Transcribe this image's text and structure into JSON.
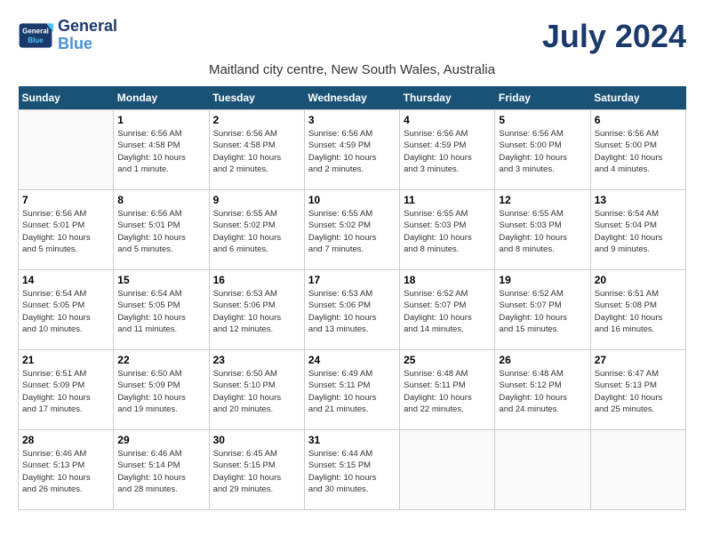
{
  "header": {
    "logo_line1": "General",
    "logo_line2": "Blue",
    "month_title": "July 2024",
    "location": "Maitland city centre, New South Wales, Australia"
  },
  "calendar": {
    "days_of_week": [
      "Sunday",
      "Monday",
      "Tuesday",
      "Wednesday",
      "Thursday",
      "Friday",
      "Saturday"
    ],
    "weeks": [
      [
        {
          "day": "",
          "info": ""
        },
        {
          "day": "1",
          "info": "Sunrise: 6:56 AM\nSunset: 4:58 PM\nDaylight: 10 hours\nand 1 minute."
        },
        {
          "day": "2",
          "info": "Sunrise: 6:56 AM\nSunset: 4:58 PM\nDaylight: 10 hours\nand 2 minutes."
        },
        {
          "day": "3",
          "info": "Sunrise: 6:56 AM\nSunset: 4:59 PM\nDaylight: 10 hours\nand 2 minutes."
        },
        {
          "day": "4",
          "info": "Sunrise: 6:56 AM\nSunset: 4:59 PM\nDaylight: 10 hours\nand 3 minutes."
        },
        {
          "day": "5",
          "info": "Sunrise: 6:56 AM\nSunset: 5:00 PM\nDaylight: 10 hours\nand 3 minutes."
        },
        {
          "day": "6",
          "info": "Sunrise: 6:56 AM\nSunset: 5:00 PM\nDaylight: 10 hours\nand 4 minutes."
        }
      ],
      [
        {
          "day": "7",
          "info": "Sunrise: 6:56 AM\nSunset: 5:01 PM\nDaylight: 10 hours\nand 5 minutes."
        },
        {
          "day": "8",
          "info": "Sunrise: 6:56 AM\nSunset: 5:01 PM\nDaylight: 10 hours\nand 5 minutes."
        },
        {
          "day": "9",
          "info": "Sunrise: 6:55 AM\nSunset: 5:02 PM\nDaylight: 10 hours\nand 6 minutes."
        },
        {
          "day": "10",
          "info": "Sunrise: 6:55 AM\nSunset: 5:02 PM\nDaylight: 10 hours\nand 7 minutes."
        },
        {
          "day": "11",
          "info": "Sunrise: 6:55 AM\nSunset: 5:03 PM\nDaylight: 10 hours\nand 8 minutes."
        },
        {
          "day": "12",
          "info": "Sunrise: 6:55 AM\nSunset: 5:03 PM\nDaylight: 10 hours\nand 8 minutes."
        },
        {
          "day": "13",
          "info": "Sunrise: 6:54 AM\nSunset: 5:04 PM\nDaylight: 10 hours\nand 9 minutes."
        }
      ],
      [
        {
          "day": "14",
          "info": "Sunrise: 6:54 AM\nSunset: 5:05 PM\nDaylight: 10 hours\nand 10 minutes."
        },
        {
          "day": "15",
          "info": "Sunrise: 6:54 AM\nSunset: 5:05 PM\nDaylight: 10 hours\nand 11 minutes."
        },
        {
          "day": "16",
          "info": "Sunrise: 6:53 AM\nSunset: 5:06 PM\nDaylight: 10 hours\nand 12 minutes."
        },
        {
          "day": "17",
          "info": "Sunrise: 6:53 AM\nSunset: 5:06 PM\nDaylight: 10 hours\nand 13 minutes."
        },
        {
          "day": "18",
          "info": "Sunrise: 6:52 AM\nSunset: 5:07 PM\nDaylight: 10 hours\nand 14 minutes."
        },
        {
          "day": "19",
          "info": "Sunrise: 6:52 AM\nSunset: 5:07 PM\nDaylight: 10 hours\nand 15 minutes."
        },
        {
          "day": "20",
          "info": "Sunrise: 6:51 AM\nSunset: 5:08 PM\nDaylight: 10 hours\nand 16 minutes."
        }
      ],
      [
        {
          "day": "21",
          "info": "Sunrise: 6:51 AM\nSunset: 5:09 PM\nDaylight: 10 hours\nand 17 minutes."
        },
        {
          "day": "22",
          "info": "Sunrise: 6:50 AM\nSunset: 5:09 PM\nDaylight: 10 hours\nand 19 minutes."
        },
        {
          "day": "23",
          "info": "Sunrise: 6:50 AM\nSunset: 5:10 PM\nDaylight: 10 hours\nand 20 minutes."
        },
        {
          "day": "24",
          "info": "Sunrise: 6:49 AM\nSunset: 5:11 PM\nDaylight: 10 hours\nand 21 minutes."
        },
        {
          "day": "25",
          "info": "Sunrise: 6:48 AM\nSunset: 5:11 PM\nDaylight: 10 hours\nand 22 minutes."
        },
        {
          "day": "26",
          "info": "Sunrise: 6:48 AM\nSunset: 5:12 PM\nDaylight: 10 hours\nand 24 minutes."
        },
        {
          "day": "27",
          "info": "Sunrise: 6:47 AM\nSunset: 5:13 PM\nDaylight: 10 hours\nand 25 minutes."
        }
      ],
      [
        {
          "day": "28",
          "info": "Sunrise: 6:46 AM\nSunset: 5:13 PM\nDaylight: 10 hours\nand 26 minutes."
        },
        {
          "day": "29",
          "info": "Sunrise: 6:46 AM\nSunset: 5:14 PM\nDaylight: 10 hours\nand 28 minutes."
        },
        {
          "day": "30",
          "info": "Sunrise: 6:45 AM\nSunset: 5:15 PM\nDaylight: 10 hours\nand 29 minutes."
        },
        {
          "day": "31",
          "info": "Sunrise: 6:44 AM\nSunset: 5:15 PM\nDaylight: 10 hours\nand 30 minutes."
        },
        {
          "day": "",
          "info": ""
        },
        {
          "day": "",
          "info": ""
        },
        {
          "day": "",
          "info": ""
        }
      ]
    ]
  }
}
